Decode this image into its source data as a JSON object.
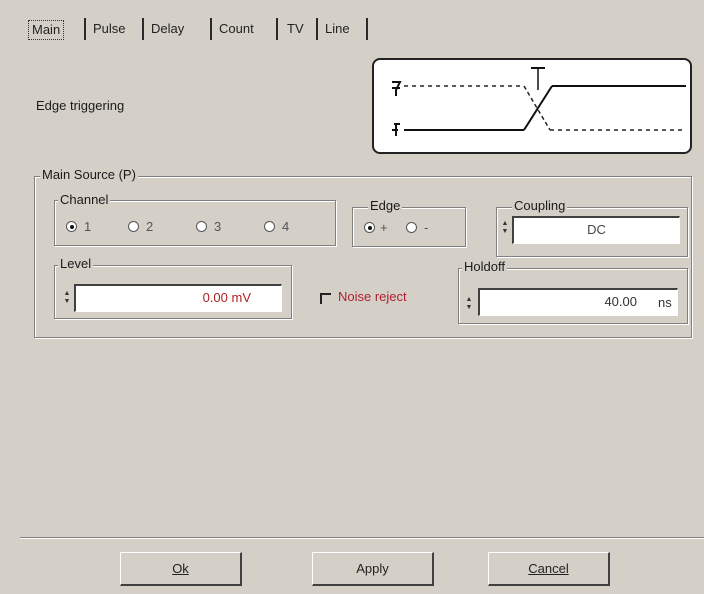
{
  "tabs": [
    "Main",
    "Pulse",
    "Delay",
    "Count",
    "TV",
    "Line"
  ],
  "header": {
    "mode_label": "Edge triggering"
  },
  "main_source": {
    "title": "Main Source (P)",
    "channel": {
      "title": "Channel",
      "options": [
        "1",
        "2",
        "3",
        "4"
      ],
      "selected": "1"
    },
    "edge": {
      "title": "Edge",
      "options": [
        "+",
        "-"
      ],
      "selected": "+"
    },
    "coupling": {
      "title": "Coupling",
      "value": "DC"
    },
    "level": {
      "title": "Level",
      "value": "0.00 mV"
    },
    "noise_reject": {
      "label": "Noise reject",
      "checked": false
    },
    "holdoff": {
      "title": "Holdoff",
      "value": "40.00",
      "unit": "ns"
    }
  },
  "buttons": {
    "ok": "Ok",
    "apply": "Apply",
    "cancel": "Cancel"
  }
}
